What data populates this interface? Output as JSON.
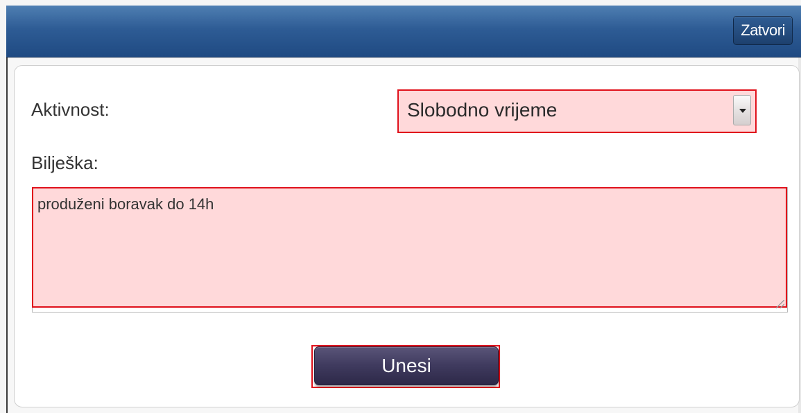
{
  "dialog": {
    "close_label": "Zatvori"
  },
  "form": {
    "activity_label": "Aktivnost:",
    "activity_value": "Slobodno vrijeme",
    "note_label": "Bilješka:",
    "note_value": "produženi boravak do 14h",
    "submit_label": "Unesi"
  },
  "colors": {
    "titlebar": "#2e5c95",
    "invalid_fill": "#ffd9da",
    "invalid_border": "#e0111b",
    "submit_button": "#3f3a5e"
  }
}
